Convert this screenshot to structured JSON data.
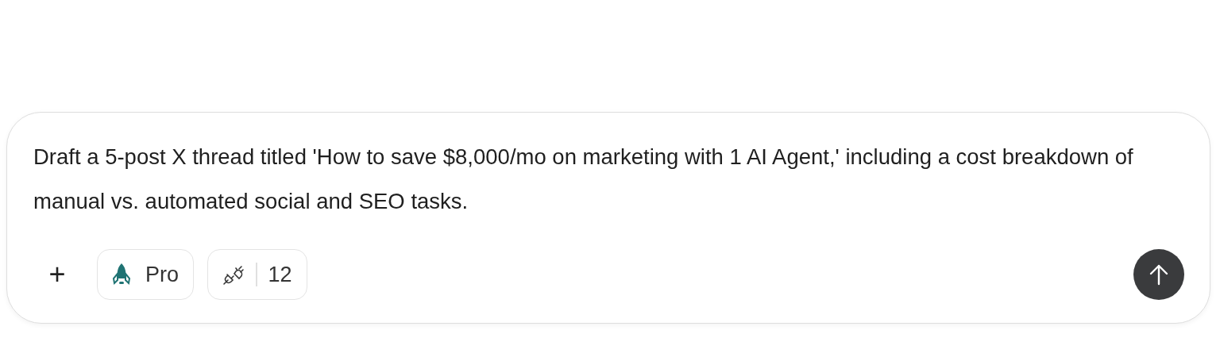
{
  "prompt": {
    "value": "Draft a 5-post X thread titled 'How to save $8,000/mo on marketing with 1 AI Agent,' including a cost breakdown of manual vs. automated social and SEO tasks."
  },
  "toolbar": {
    "add": "+",
    "chips": [
      {
        "kind": "mode",
        "label": "Pro"
      },
      {
        "kind": "tools",
        "label": "12"
      }
    ]
  }
}
